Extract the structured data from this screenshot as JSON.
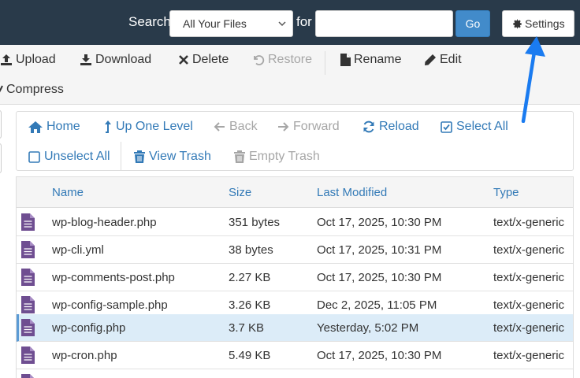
{
  "search": {
    "label": "Search",
    "scope": "All Your Files",
    "for_label": "for",
    "query_value": "",
    "go_label": "Go",
    "settings_label": "Settings"
  },
  "toolbar": {
    "upload": "Upload",
    "download": "Download",
    "delete": "Delete",
    "restore": "Restore",
    "rename": "Rename",
    "edit": "Edit",
    "compress": "Compress"
  },
  "nav": {
    "home": "Home",
    "up": "Up One Level",
    "back": "Back",
    "forward": "Forward",
    "reload": "Reload",
    "select_all": "Select All",
    "unselect_all": "Unselect All",
    "view_trash": "View Trash",
    "empty_trash": "Empty Trash"
  },
  "table": {
    "columns": {
      "name": "Name",
      "size": "Size",
      "modified": "Last Modified",
      "type": "Type"
    },
    "rows": [
      {
        "name": "wp-blog-header.php",
        "size": "351 bytes",
        "modified": "Oct 17, 2025, 10:30 PM",
        "type": "text/x-generic"
      },
      {
        "name": "wp-cli.yml",
        "size": "38 bytes",
        "modified": "Oct 17, 2025, 10:31 PM",
        "type": "text/x-generic"
      },
      {
        "name": "wp-comments-post.php",
        "size": "2.27 KB",
        "modified": "Oct 17, 2025, 10:30 PM",
        "type": "text/x-generic"
      },
      {
        "name": "wp-config-sample.php",
        "size": "3.26 KB",
        "modified": "Dec 2, 2025, 11:05 PM",
        "type": "text/x-generic"
      },
      {
        "name": "wp-config.php",
        "size": "3.7 KB",
        "modified": "Yesterday, 5:02 PM",
        "type": "text/x-generic"
      },
      {
        "name": "wp-cron.php",
        "size": "5.49 KB",
        "modified": "Oct 17, 2025, 10:30 PM",
        "type": "text/x-generic"
      }
    ]
  },
  "colors": {
    "topbar": "#293a4a",
    "link": "#337ab7",
    "primary": "#428bca",
    "file_icon": "#6f4e91",
    "selected_row": "#dcecf8",
    "annotation_arrow": "#1a7bf0"
  }
}
